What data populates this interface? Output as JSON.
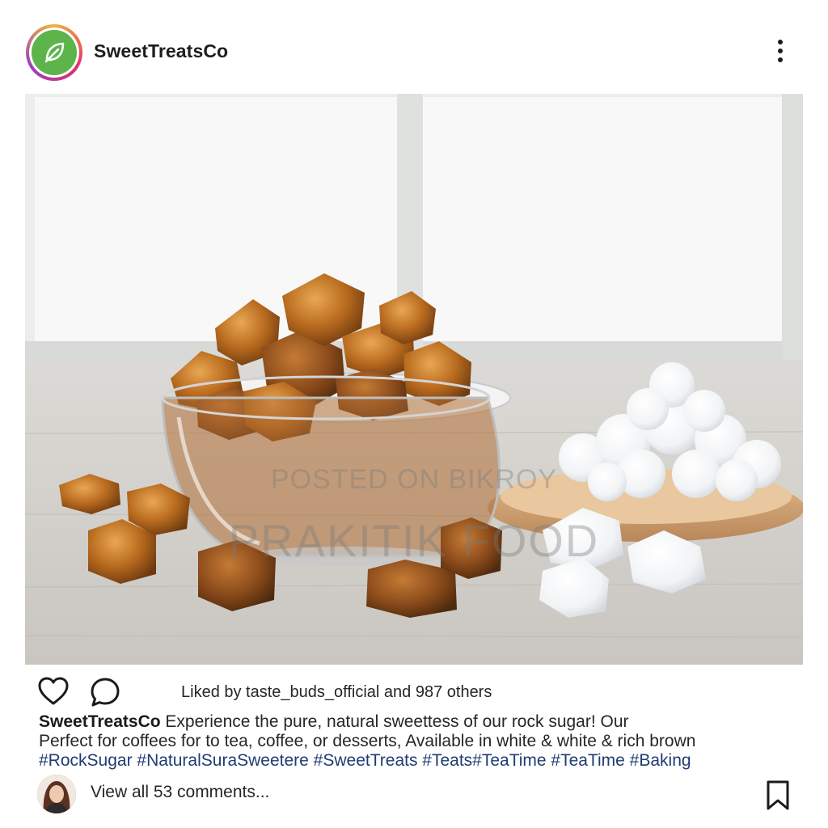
{
  "post": {
    "username": "SweetTreatsCo",
    "more_icon": "more-vertical-icon",
    "watermark_line1": "POSTED ON BIKROY",
    "watermark_line2": "PRAKITIK FOOD",
    "likes_text": "Liked by taste_buds_official and 987 others",
    "caption": {
      "username": "SweetTreatsCo",
      "line1": "Experience the pure, natural sweettess of our rock sugar! Our",
      "line2": "Perfect for coffees for to tea, coffee, or desserts, Available in white & white & rich brown",
      "hashtags": "#RockSugar #NaturalSuraSweetere #SweetTreats #Teats#TeaTime #TeaTime #Baking"
    },
    "view_comments": "View all 53 comments...",
    "icons": [
      "heart-icon",
      "comment-icon",
      "bookmark-icon",
      "leaf-icon"
    ],
    "colors": {
      "hashtag": "#1f3c73",
      "avatar_green": "#5cb44b",
      "text": "#262626"
    }
  }
}
